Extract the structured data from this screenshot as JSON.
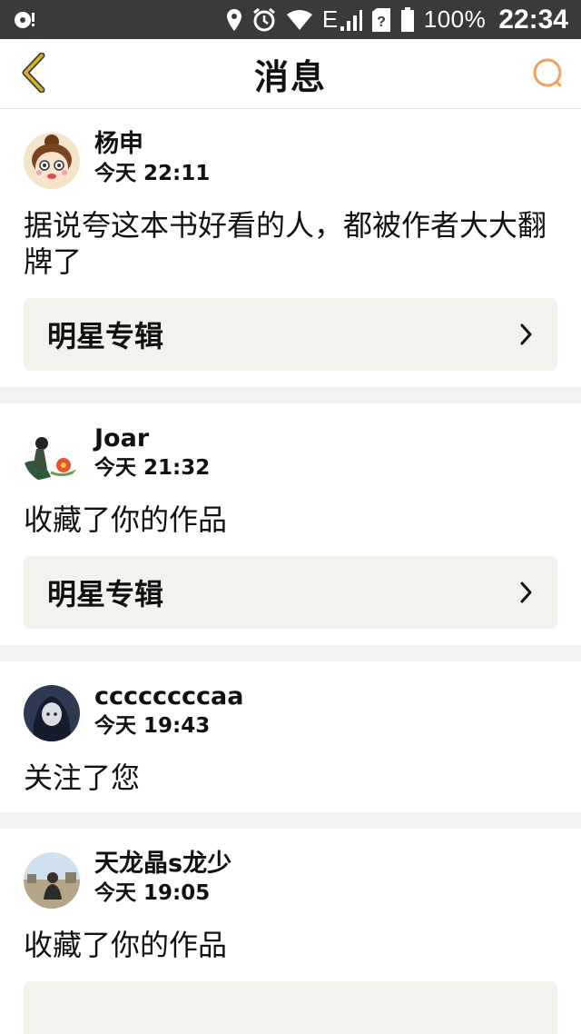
{
  "status_bar": {
    "battery_text": "100%",
    "clock": "22:34",
    "network": "E"
  },
  "header": {
    "title": "消息",
    "accent_color": "#f0a060",
    "back_color": "#d8b02a"
  },
  "messages": [
    {
      "user": "杨申",
      "time": "今天 22:11",
      "text": "据说夸这本书好看的人，都被作者大大翻牌了",
      "ref_title": "明星专辑",
      "avatar_icon": "cartoon-girl-avatar"
    },
    {
      "user": "Joar",
      "time": "今天 21:32",
      "text": "收藏了你的作品",
      "ref_title": "明星专辑",
      "avatar_icon": "illustration-avatar"
    },
    {
      "user": "ccccccccaa",
      "time": "今天 19:43",
      "text": "关注了您",
      "avatar_icon": "anime-girl-avatar"
    },
    {
      "user": "天龙晶s龙少",
      "time": "今天 19:05",
      "text": "收藏了你的作品",
      "avatar_icon": "photo-avatar"
    }
  ]
}
